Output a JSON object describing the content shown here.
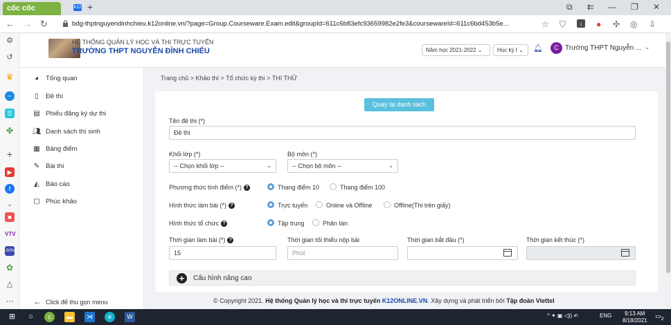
{
  "browser": {
    "brand": "cốc cốc",
    "url": "bdg-thptnguyendinhchieu.k12online.vn/?page=Group.Courseware.Exam.edit&groupId=611c6b83efc93659982e2fe3&coursewareId=611c6bd453b5e..."
  },
  "header": {
    "system_title": "HỆ THỐNG QUẢN LÝ HỌC VÀ THI TRỰC TUYẾN",
    "school_name": "TRƯỜNG THPT NGUYỄN ĐÌNH CHIỂU",
    "school_year": "Năm học 2021-2022",
    "semester": "Học kỳ I",
    "avatar_letter": "C",
    "user_name": "Trường THPT Nguyễn ..."
  },
  "sidebar": {
    "items": [
      {
        "label": "Tổng quan",
        "icon": "pie-chart-icon"
      },
      {
        "label": "Đề thi",
        "icon": "file-icon"
      },
      {
        "label": "Phiếu đăng ký dự thi",
        "icon": "file-text-icon"
      },
      {
        "label": "Danh sách thí sinh",
        "icon": "users-icon"
      },
      {
        "label": "Bảng điểm",
        "icon": "list-icon"
      },
      {
        "label": "Bài thi",
        "icon": "edit-icon"
      },
      {
        "label": "Báo cáo",
        "icon": "area-chart-icon"
      },
      {
        "label": "Phúc khảo",
        "icon": "clipboard-icon"
      }
    ],
    "collapse_label": "Click để thu gọn menu"
  },
  "breadcrumb": "Trang chủ > Khảo thí > Tổ chức kỳ thi > THI THỬ",
  "form": {
    "back_button": "Quay lại danh sách",
    "exam_name_label": "Tên đề thi (*)",
    "exam_name_value": "Đề thi",
    "grade_label": "Khối lớp (*)",
    "grade_value": "-- Chọn khối lớp --",
    "subject_label": "Bộ môn (*)",
    "subject_value": "-- Chọn bộ môn --",
    "scoring_label": "Phương thức tính điểm (*)",
    "scoring_options": [
      "Thang điểm 10",
      "Thang điểm 100"
    ],
    "mode_label": "Hình thức làm bài (*)",
    "mode_options": [
      "Trực tuyến",
      "Online và Offline",
      "Offline(Thi trên giấy)"
    ],
    "org_label": "Hình thức tổ chức",
    "org_options": [
      "Tập trung",
      "Phân tán"
    ],
    "duration_label": "Thời gian làm bài (*)",
    "duration_value": "15",
    "min_submit_label": "Thời gian tối thiểu nộp bài",
    "min_submit_placeholder": "Phút",
    "start_label": "Thời gian bắt đầu (*)",
    "end_label": "Thời gian kết thúc (*)",
    "advanced_label": "Cấu hình nâng cao"
  },
  "footer": {
    "prefix": "© Copyright 2021.",
    "system": "Hệ thống Quản lý học và thi trực tuyến",
    "site": "K12ONLINE.VN",
    "middle": ". Xây dựng và phát triển bởi",
    "company": "Tập đoàn Viettel"
  },
  "taskbar": {
    "lang": "ENG",
    "time": "9:13 AM",
    "date": "8/18/2021",
    "notifications": "2"
  }
}
